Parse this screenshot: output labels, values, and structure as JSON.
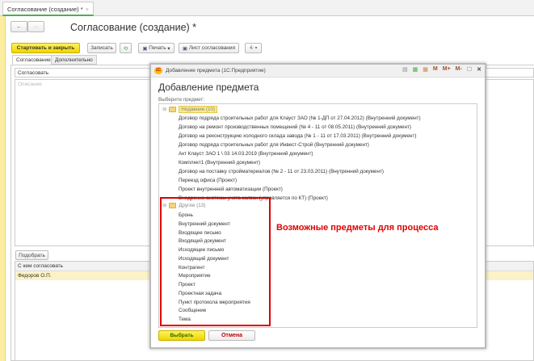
{
  "window_tab": {
    "label": "Согласование (создание) *",
    "close": "×"
  },
  "form": {
    "title": "Согласование (создание) *",
    "nav": {
      "back": "←",
      "forward": "→"
    },
    "toolbar": {
      "start_close": "Стартовать и закрыть",
      "save": "Записать",
      "print": "Печать",
      "approval_sheet": "Лист согласования",
      "attach": "⎀ ▾"
    },
    "tabs": [
      "Согласование",
      "Дополнительно"
    ],
    "action_field": "Согласовать",
    "description_placeholder": "Описание",
    "pick_button": "Подобрать",
    "table": {
      "header": "С кем согласовать",
      "rows": [
        "Федоров О.П."
      ]
    }
  },
  "dialog": {
    "window_title": "Добавление предмета  (1С:Предприятие)",
    "logo": "1С",
    "title_icons": [
      "M",
      "M+",
      "M-"
    ],
    "heading": "Добавление предмета",
    "prompt": "Выберите предмет:",
    "groups": [
      {
        "label": "Недавние (10)",
        "items": [
          "Договор подряда строительных работ для Клауст ЗАО (№ 1-ДП от 27.04.2012) (Внутренний документ)",
          "Договор на ремонт производственных помещений (№ 4 - 11 от 08.05.2011) (Внутренний документ)",
          "Договор на реконструкцию холодного склада завода (№ 1 - 11 от 17.03.2011) (Внутренний документ)",
          "Договор подряда строительных работ для Инвест-Строй (Внутренний документ)",
          "Акт Клауст ЗАО 1 \\ 03 14.03.2019 (Внутренний документ)",
          "Комплект1 (Внутренний документ)",
          "Договор на поставку стройматериалов (№ 2 - 11 от 23.03.2011) (Внутренний документ)",
          "Переезд офиса (Проект)",
          "Проект внутренней автоматизации (Проект)",
          "Внедрение системы учета заявок (управляется по КТ) (Проект)"
        ]
      },
      {
        "label": "Другие (13)",
        "items": [
          "Бронь",
          "Внутренний документ",
          "Входящее письмо",
          "Входящий документ",
          "Исходящее письмо",
          "Исходящий документ",
          "Контрагент",
          "Мероприятие",
          "Проект",
          "Проектная задача",
          "Пункт протокола мероприятия",
          "Сообщение",
          "Тема"
        ]
      }
    ],
    "select_button": "Выбрать",
    "cancel_button": "Отмена"
  },
  "annotation": "Возможные предметы для процесса",
  "colors": {
    "accent_yellow": "#f0d500",
    "annotation_red": "#e00000"
  }
}
